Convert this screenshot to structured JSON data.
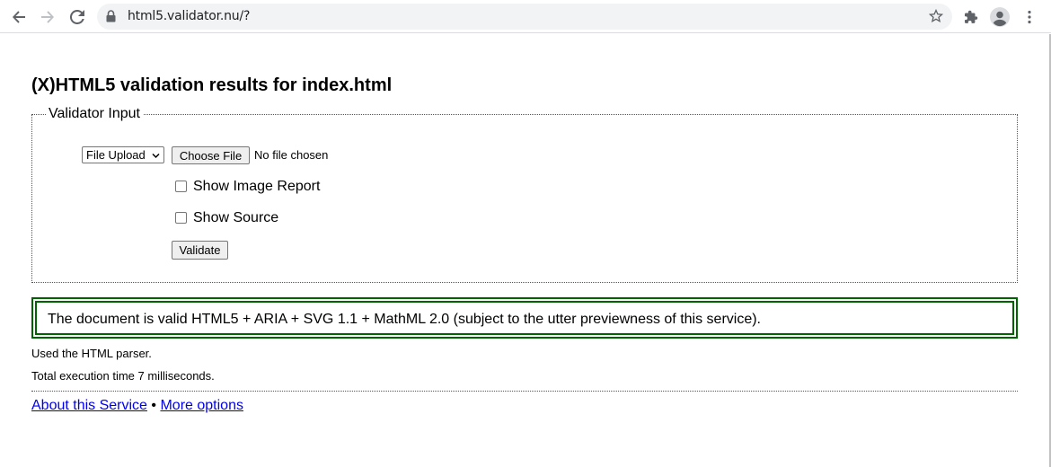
{
  "browser": {
    "url": "html5.validator.nu/?",
    "icons": [
      "back-arrow-icon",
      "forward-arrow-icon",
      "reload-icon",
      "lock-icon",
      "star-icon",
      "extensions-icon",
      "profile-icon",
      "menu-dots-icon"
    ]
  },
  "page": {
    "title": "(X)HTML5 validation results for index.html",
    "fieldset_legend": "Validator Input",
    "input_mode": {
      "selected": "File Upload",
      "options": [
        "File Upload"
      ]
    },
    "choose_file_label": "Choose File",
    "no_file_text": "No file chosen",
    "show_image_report_label": "Show Image Report",
    "show_source_label": "Show Source",
    "validate_label": "Validate",
    "success_message": "The document is valid HTML5 + ARIA + SVG 1.1 + MathML 2.0 (subject to the utter previewness of this service).",
    "parser_info": "Used the HTML parser.",
    "execution_time": "Total execution time 7 milliseconds.",
    "footer": {
      "about_link": "About this Service",
      "separator": "•",
      "more_options_link": "More options"
    }
  },
  "colors": {
    "success_border": "#006400",
    "link": "#0000ee",
    "omnibox_bg": "#f1f3f4"
  }
}
